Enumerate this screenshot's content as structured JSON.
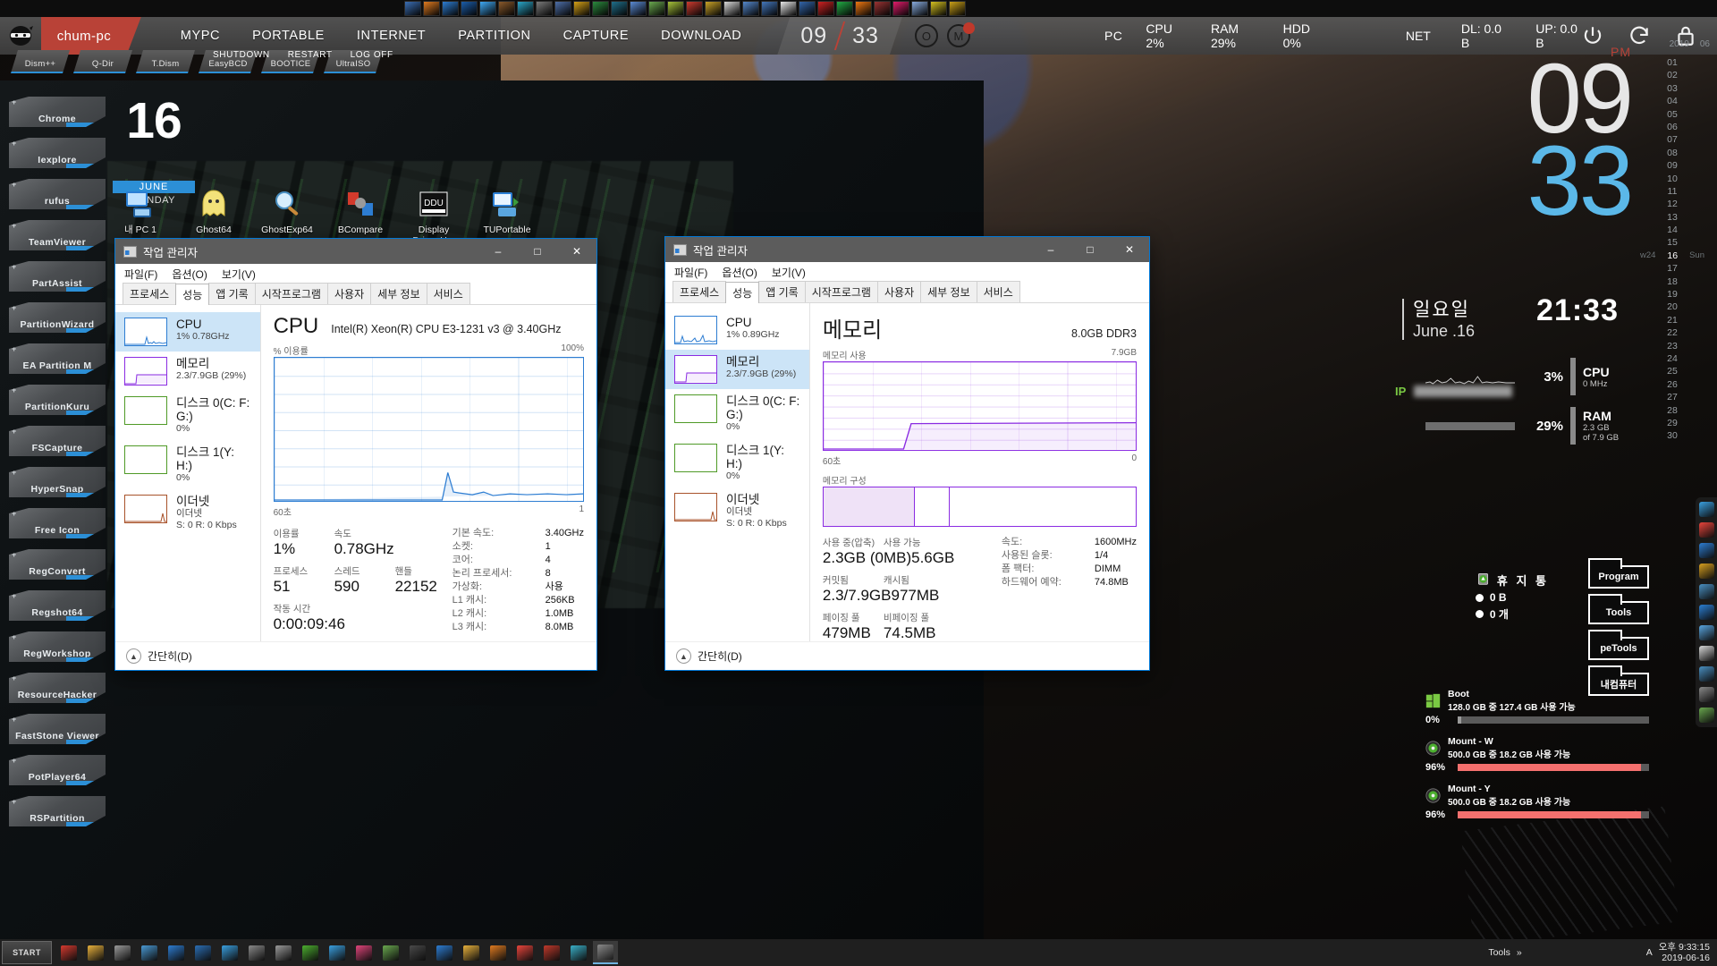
{
  "topbar": {
    "host": "chum-pc",
    "menu": [
      "MYPC",
      "PORTABLE",
      "INTERNET",
      "PARTITION",
      "CAPTURE",
      "DOWNLOAD"
    ],
    "clock_hour": "09",
    "clock_min": "33",
    "stats": [
      {
        "label": "PC",
        "value": ""
      },
      {
        "label": "CPU",
        "value": "2%"
      },
      {
        "label": "RAM",
        "value": "29%"
      },
      {
        "label": "HDD",
        "value": "0%"
      }
    ],
    "net_label": "NET",
    "download": "DL: 0.0 B",
    "upload": "UP: 0.0 B",
    "icons": {
      "power": "power-icon",
      "refresh": "refresh-icon",
      "lock": "lock-icon",
      "ninja": "ninja-logo",
      "badge1": "opera-icon",
      "badge2": "mega-icon"
    }
  },
  "top_shortcuts": [
    "Dism++",
    "Q-Dir",
    "T.Dism",
    "EasyBCD",
    "BOOTICE",
    "UltraISO"
  ],
  "power_actions": [
    "SHUTDOWN",
    "RESTART",
    "LOG OFF"
  ],
  "left_rail": [
    "Chrome",
    "Iexplore",
    "rufus",
    "TeamViewer",
    "PartAssist",
    "PartitionWizard",
    "EA Partition M",
    "PartitionKuru",
    "FSCapture",
    "HyperSnap",
    "Free Icon",
    "RegConvert",
    "Regshot64",
    "RegWorkshop",
    "ResourceHacker",
    "FastStone Viewer",
    "PotPlayer64",
    "RSPartition"
  ],
  "date_widget": {
    "day": "16",
    "month": "JUNE",
    "weekday": "SUNDAY"
  },
  "desktop_icons": [
    {
      "label": "내 PC 1",
      "icon": "computer-icon"
    },
    {
      "label": "Ghost64",
      "icon": "ghost-icon"
    },
    {
      "label": "GhostExp64",
      "icon": "magnifier-icon"
    },
    {
      "label": "BCompare",
      "icon": "bcompare-icon"
    },
    {
      "label": "Display Driver U...",
      "icon": "ddu-icon"
    },
    {
      "label": "TUPortable",
      "icon": "tuneup-icon"
    }
  ],
  "taskmgr_left": {
    "title": "작업 관리자",
    "menu": [
      "파일(F)",
      "옵션(O)",
      "보기(V)"
    ],
    "tabs": [
      "프로세스",
      "성능",
      "앱 기록",
      "시작프로그램",
      "사용자",
      "세부 정보",
      "서비스"
    ],
    "active_tab": "성능",
    "list": [
      {
        "name": "CPU",
        "sub": "1% 0.78GHz",
        "sub2": "",
        "selected": true,
        "color": "blue"
      },
      {
        "name": "메모리",
        "sub": "2.3/7.9GB (29%)",
        "sub2": "",
        "selected": false,
        "color": "purple"
      },
      {
        "name": "디스크 0(C: F: G:)",
        "sub": "0%",
        "sub2": "",
        "selected": false,
        "color": "green"
      },
      {
        "name": "디스크 1(Y: H:)",
        "sub": "0%",
        "sub2": "",
        "selected": false,
        "color": "green"
      },
      {
        "name": "이더넷",
        "sub": "이더넷",
        "sub2": "S: 0 R: 0 Kbps",
        "selected": false,
        "color": "orange"
      }
    ],
    "detail": {
      "heading": "CPU",
      "model": "Intel(R) Xeon(R) CPU E3-1231 v3 @ 3.40GHz",
      "graph_label": "% 이용률",
      "graph_max": "100%",
      "axis_left": "60초",
      "axis_right": "1",
      "groups": [
        {
          "labels": [
            "이용률",
            "속도"
          ],
          "values": [
            "1%",
            "0.78GHz"
          ]
        },
        {
          "labels": [
            "프로세스",
            "스레드",
            "핸들"
          ],
          "values": [
            "51",
            "590",
            "22152"
          ]
        },
        {
          "labels": [
            "작동 시간"
          ],
          "values": [
            "0:00:09:46"
          ]
        }
      ],
      "specs": [
        {
          "k": "기본 속도:",
          "v": "3.40GHz"
        },
        {
          "k": "소켓:",
          "v": "1"
        },
        {
          "k": "코어:",
          "v": "4"
        },
        {
          "k": "논리 프로세서:",
          "v": "8"
        },
        {
          "k": "가상화:",
          "v": "사용"
        },
        {
          "k": "L1 캐시:",
          "v": "256KB"
        },
        {
          "k": "L2 캐시:",
          "v": "1.0MB"
        },
        {
          "k": "L3 캐시:",
          "v": "8.0MB"
        }
      ]
    },
    "footer": "간단히(D)"
  },
  "taskmgr_right": {
    "title": "작업 관리자",
    "menu": [
      "파일(F)",
      "옵션(O)",
      "보기(V)"
    ],
    "tabs": [
      "프로세스",
      "성능",
      "앱 기록",
      "시작프로그램",
      "사용자",
      "세부 정보",
      "서비스"
    ],
    "active_tab": "성능",
    "list": [
      {
        "name": "CPU",
        "sub": "1% 0.89GHz",
        "sub2": "",
        "selected": false,
        "color": "blue"
      },
      {
        "name": "메모리",
        "sub": "2.3/7.9GB (29%)",
        "sub2": "",
        "selected": true,
        "color": "purple"
      },
      {
        "name": "디스크 0(C: F: G:)",
        "sub": "0%",
        "sub2": "",
        "selected": false,
        "color": "green"
      },
      {
        "name": "디스크 1(Y: H:)",
        "sub": "0%",
        "sub2": "",
        "selected": false,
        "color": "green"
      },
      {
        "name": "이더넷",
        "sub": "이더넷",
        "sub2": "S: 0 R: 0 Kbps",
        "selected": false,
        "color": "orange"
      }
    ],
    "detail": {
      "heading": "메모리",
      "model": "8.0GB DDR3",
      "graph_label": "메모리 사용",
      "graph_max": "7.9GB",
      "axis_left": "60초",
      "axis_right": "0",
      "composition_label": "메모리 구성",
      "groups": [
        {
          "labels": [
            "사용 중(압축)",
            "사용 가능"
          ],
          "values": [
            "2.3GB (0MB)",
            "5.6GB"
          ]
        },
        {
          "labels": [
            "커밋됨",
            "캐시됨"
          ],
          "values": [
            "2.3/7.9GB",
            "977MB"
          ]
        },
        {
          "labels": [
            "페이징 풀",
            "비페이징 풀"
          ],
          "values": [
            "479MB",
            "74.5MB"
          ]
        }
      ],
      "specs": [
        {
          "k": "속도:",
          "v": "1600MHz"
        },
        {
          "k": "사용된 슬롯:",
          "v": "1/4"
        },
        {
          "k": "폼 팩터:",
          "v": "DIMM"
        },
        {
          "k": "하드웨어 예약:",
          "v": "74.8MB"
        }
      ]
    },
    "footer": "간단히(D)"
  },
  "sidebar": {
    "pm": "PM",
    "clock_hour": "09",
    "clock_min": "33",
    "year": "2019",
    "month": "06",
    "week_marker": "w24",
    "selected_day": "16",
    "selected_weekday": "Sun",
    "time": "21:33",
    "weekday_ko": "일요일",
    "date_en": "June .16",
    "cpu": {
      "pct": "3%",
      "name": "CPU",
      "sub": "0 MHz"
    },
    "ram": {
      "pct": "29%",
      "name": "RAM",
      "sub1": "2.3 GB",
      "sub2": "of 7.9 GB"
    },
    "ip_label": "IP",
    "recycle": {
      "title": "휴 지 통",
      "size": "0 B",
      "count": "0 개"
    },
    "folders": [
      "Program",
      "Tools",
      "peTools",
      "내컴퓨터"
    ],
    "drives": [
      {
        "name": "Boot",
        "capacity": "128.0 GB 중 127.4 GB 사용 가능",
        "pct": "0%",
        "fill": 2,
        "color": "#9a9a9a",
        "icon": "windows-icon"
      },
      {
        "name": "Mount - W",
        "capacity": "500.0 GB 중 18.2 GB 사용 가능",
        "pct": "96%",
        "fill": 96,
        "color": "#f4706e",
        "icon": "disc-icon"
      },
      {
        "name": "Mount - Y",
        "capacity": "500.0 GB 중 18.2 GB 사용 가능",
        "pct": "96%",
        "fill": 96,
        "color": "#f4706e",
        "icon": "disc-icon"
      }
    ]
  },
  "taskbar": {
    "start": "START",
    "tools_label": "Tools",
    "chevron": "»",
    "time": "오후 9:33:15",
    "date": "2019-06-16",
    "ime": "A"
  }
}
